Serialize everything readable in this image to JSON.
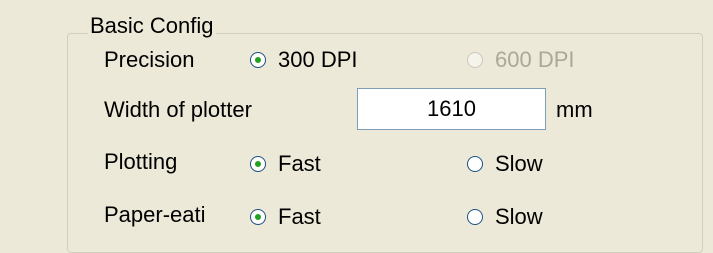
{
  "group": {
    "title": "Basic Config"
  },
  "precision": {
    "label": "Precision",
    "options": [
      {
        "label": "300 DPI",
        "selected": true,
        "enabled": true
      },
      {
        "label": "600 DPI",
        "selected": false,
        "enabled": false
      }
    ]
  },
  "width": {
    "label": "Width of plotter",
    "value": "1610",
    "unit": "mm"
  },
  "plotting": {
    "label": "Plotting",
    "options": [
      {
        "label": "Fast",
        "selected": true,
        "enabled": true
      },
      {
        "label": "Slow",
        "selected": false,
        "enabled": true
      }
    ]
  },
  "paper_eating": {
    "label": "Paper-eati",
    "options": [
      {
        "label": "Fast",
        "selected": true,
        "enabled": true
      },
      {
        "label": "Slow",
        "selected": false,
        "enabled": true
      }
    ]
  },
  "colors": {
    "background": "#ece9d8",
    "radio_dot": "#21a121",
    "disabled_text": "#aca899"
  }
}
